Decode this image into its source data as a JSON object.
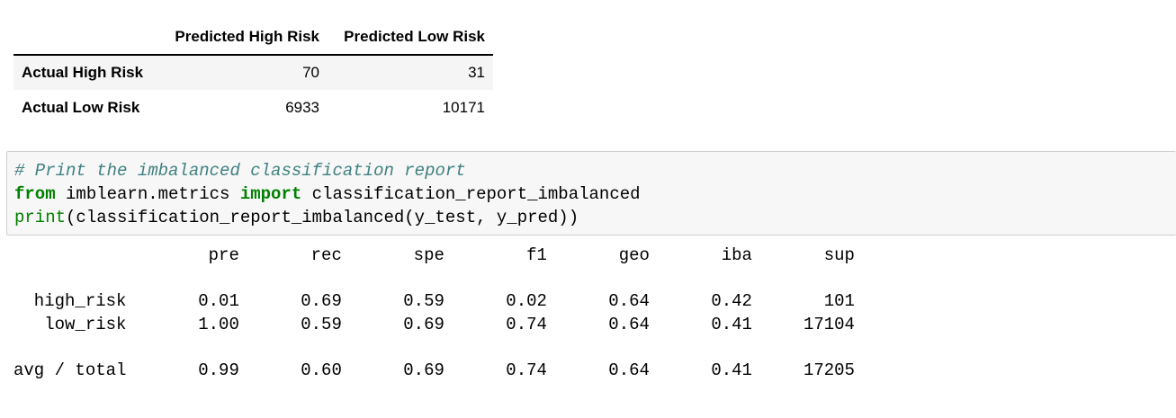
{
  "confusion_matrix": {
    "columns": [
      "Predicted High Risk",
      "Predicted Low Risk"
    ],
    "rows": [
      {
        "label": "Actual High Risk",
        "values": [
          "70",
          "31"
        ]
      },
      {
        "label": "Actual Low Risk",
        "values": [
          "6933",
          "10171"
        ]
      }
    ]
  },
  "code_cell": {
    "comment": "# Print the imbalanced classification report",
    "line2": {
      "kw_from": "from",
      "module": " imblearn.metrics ",
      "kw_import": "import",
      "name": " classification_report_imbalanced"
    },
    "line3": {
      "builtin": "print",
      "rest": "(classification_report_imbalanced(y_test, y_pred))"
    }
  },
  "report_output": {
    "header": "                   pre       rec       spe        f1       geo       iba       sup",
    "blank1": "",
    "row_high": "  high_risk       0.01      0.69      0.59      0.02      0.64      0.42       101",
    "row_low": "   low_risk       1.00      0.59      0.69      0.74      0.64      0.41     17104",
    "blank2": "",
    "row_total": "avg / total       0.99      0.60      0.69      0.74      0.64      0.41     17205"
  }
}
